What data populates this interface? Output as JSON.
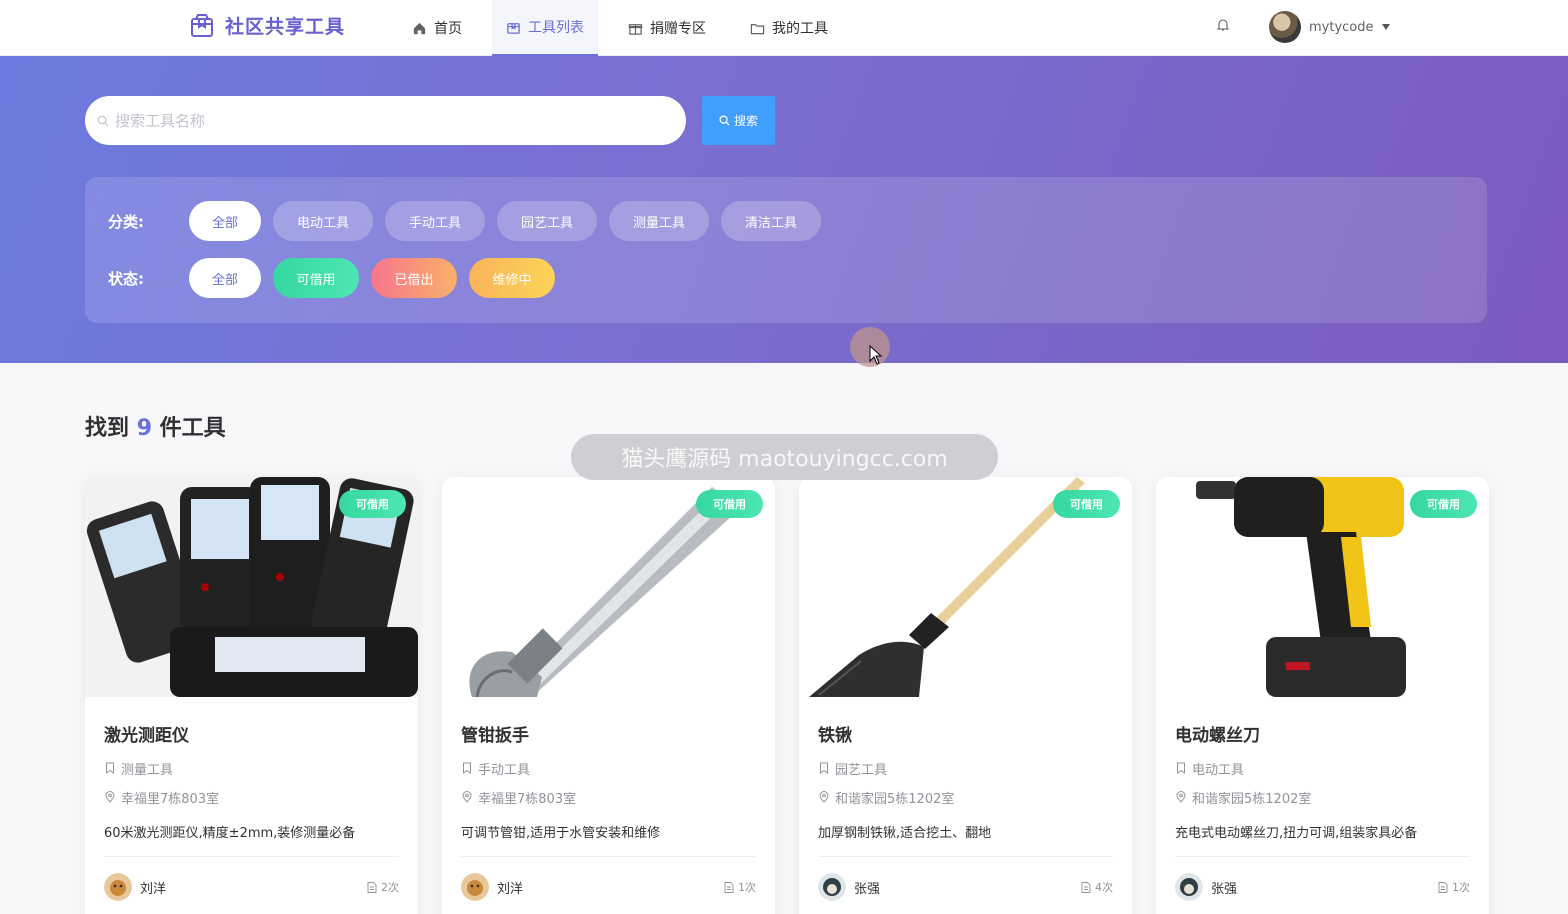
{
  "header": {
    "brand": "社区共享工具",
    "nav": [
      {
        "label": "首页",
        "icon": "home-icon"
      },
      {
        "label": "工具列表",
        "icon": "box-icon"
      },
      {
        "label": "捐赠专区",
        "icon": "gift-icon"
      },
      {
        "label": "我的工具",
        "icon": "folder-icon"
      }
    ],
    "active_nav": "工具列表",
    "username": "mytycode"
  },
  "search": {
    "placeholder": "搜索工具名称",
    "value": "",
    "button_label": "搜索"
  },
  "filters": {
    "category_label": "分类:",
    "categories": [
      "全部",
      "电动工具",
      "手动工具",
      "园艺工具",
      "测量工具",
      "清洁工具"
    ],
    "selected_category": "全部",
    "status_label": "状态:",
    "statuses": [
      "全部",
      "可借用",
      "已借出",
      "维修中"
    ],
    "selected_status": "全部"
  },
  "results": {
    "prefix": "找到",
    "count": "9",
    "suffix": "件工具"
  },
  "watermark": "猫头鹰源码 maotouyingcc.com",
  "cards": [
    {
      "name": "激光测距仪",
      "status": "可借用",
      "category": "测量工具",
      "location": "幸福里7栋803室",
      "description": "60米激光测距仪,精度±2mm,装修测量必备",
      "owner": "刘洋",
      "borrow_count": "2次",
      "image": "laser-rangefinder"
    },
    {
      "name": "管钳扳手",
      "status": "可借用",
      "category": "手动工具",
      "location": "幸福里7栋803室",
      "description": "可调节管钳,适用于水管安装和维修",
      "owner": "刘洋",
      "borrow_count": "1次",
      "image": "adjustable-wrench"
    },
    {
      "name": "铁锹",
      "status": "可借用",
      "category": "园艺工具",
      "location": "和谐家园5栋1202室",
      "description": "加厚钢制铁锹,适合挖土、翻地",
      "owner": "张强",
      "borrow_count": "4次",
      "image": "shovel"
    },
    {
      "name": "电动螺丝刀",
      "status": "可借用",
      "category": "电动工具",
      "location": "和谐家园5栋1202室",
      "description": "充电式电动螺丝刀,扭力可调,组装家具必备",
      "owner": "张强",
      "borrow_count": "1次",
      "image": "cordless-drill"
    }
  ],
  "colors": {
    "accent": "#6a70d8",
    "search_button": "#409eff",
    "available": "#36d7a0",
    "borrowed": "#f7758c",
    "repair": "#f9b35a"
  }
}
